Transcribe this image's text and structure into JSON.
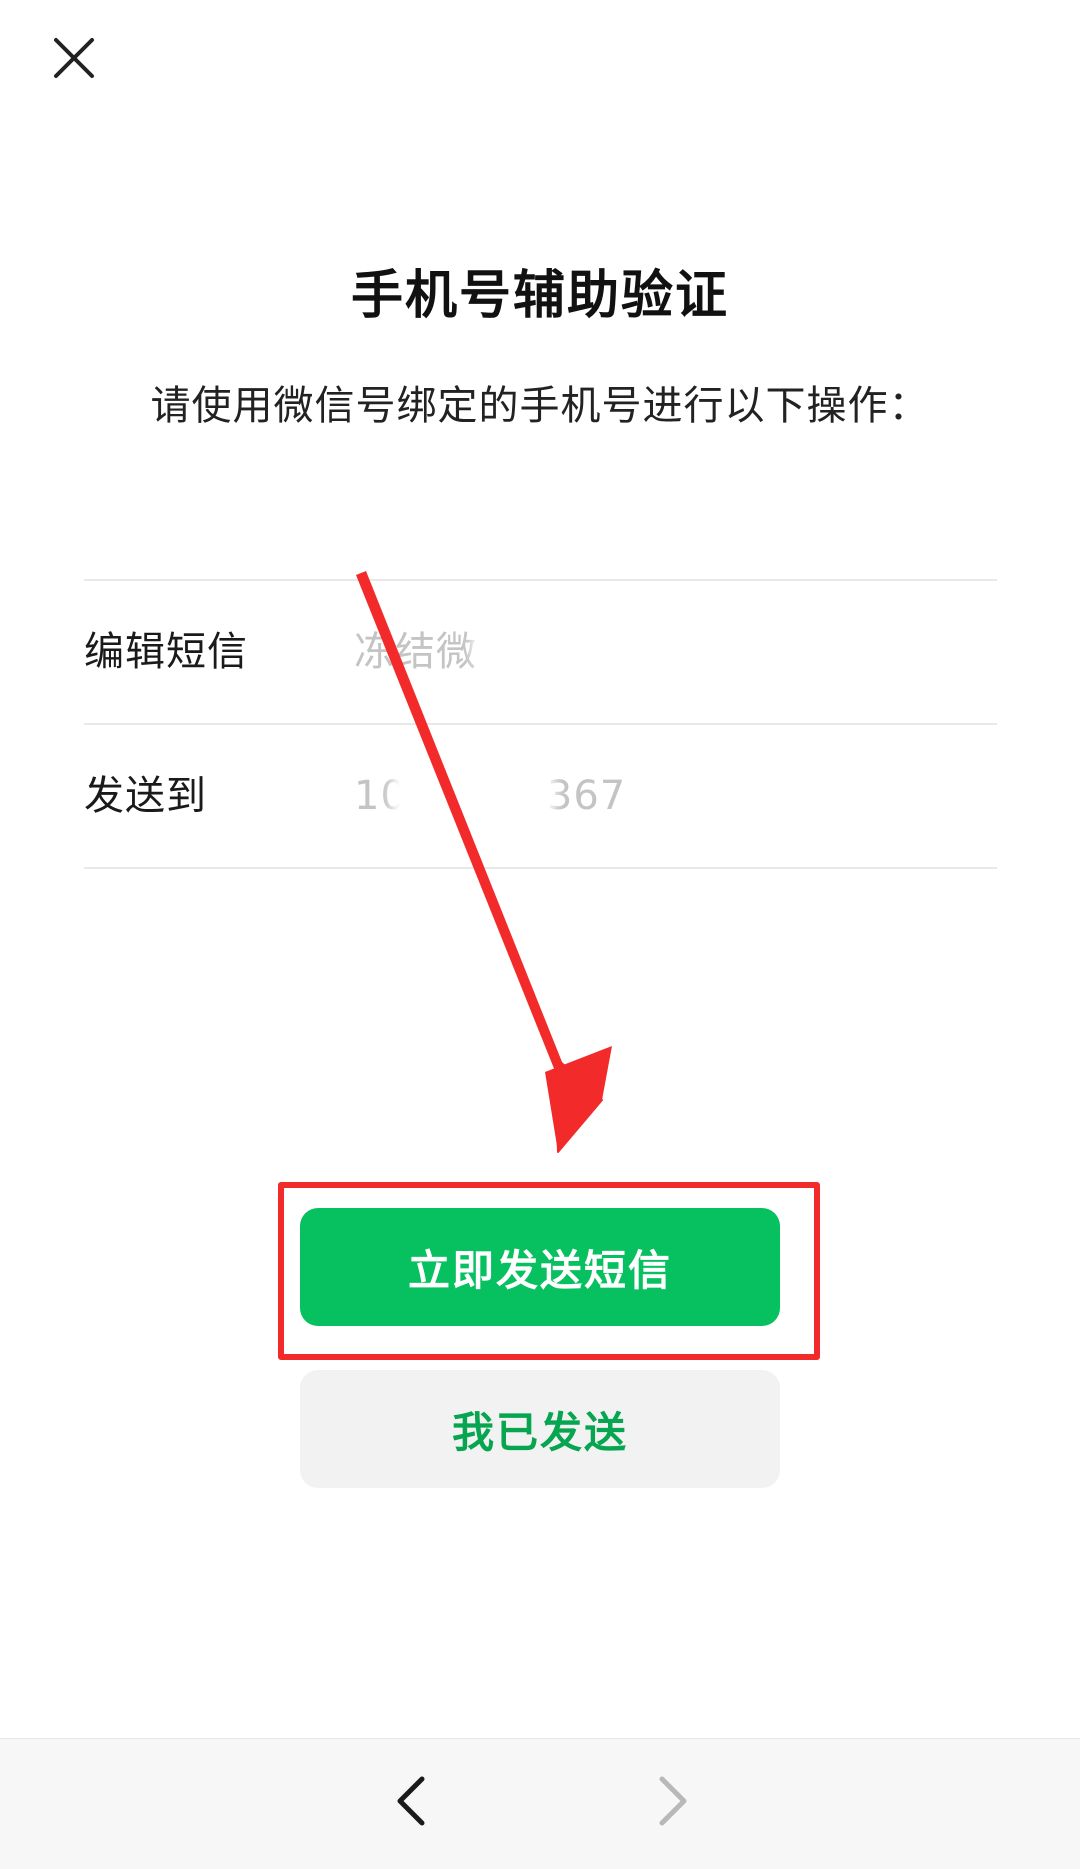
{
  "header": {
    "close_icon": "close-icon"
  },
  "page": {
    "title": "手机号辅助验证",
    "subtitle": "请使用微信号绑定的手机号进行以下操作："
  },
  "info": {
    "rows": [
      {
        "label": "编辑短信",
        "value": "冻结微"
      },
      {
        "label": "发送到",
        "value_prefix": "10",
        "value_suffix": "367"
      }
    ]
  },
  "actions": {
    "primary_label": "立即发送短信",
    "secondary_label": "我已发送"
  },
  "colors": {
    "primary": "#07c160",
    "secondary_bg": "#f2f2f2",
    "secondary_text": "#07a550",
    "annotation": "#f22a2a"
  },
  "bottom_nav": {
    "back_icon": "chevron-left-icon",
    "forward_icon": "chevron-right-icon",
    "forward_enabled": false
  }
}
